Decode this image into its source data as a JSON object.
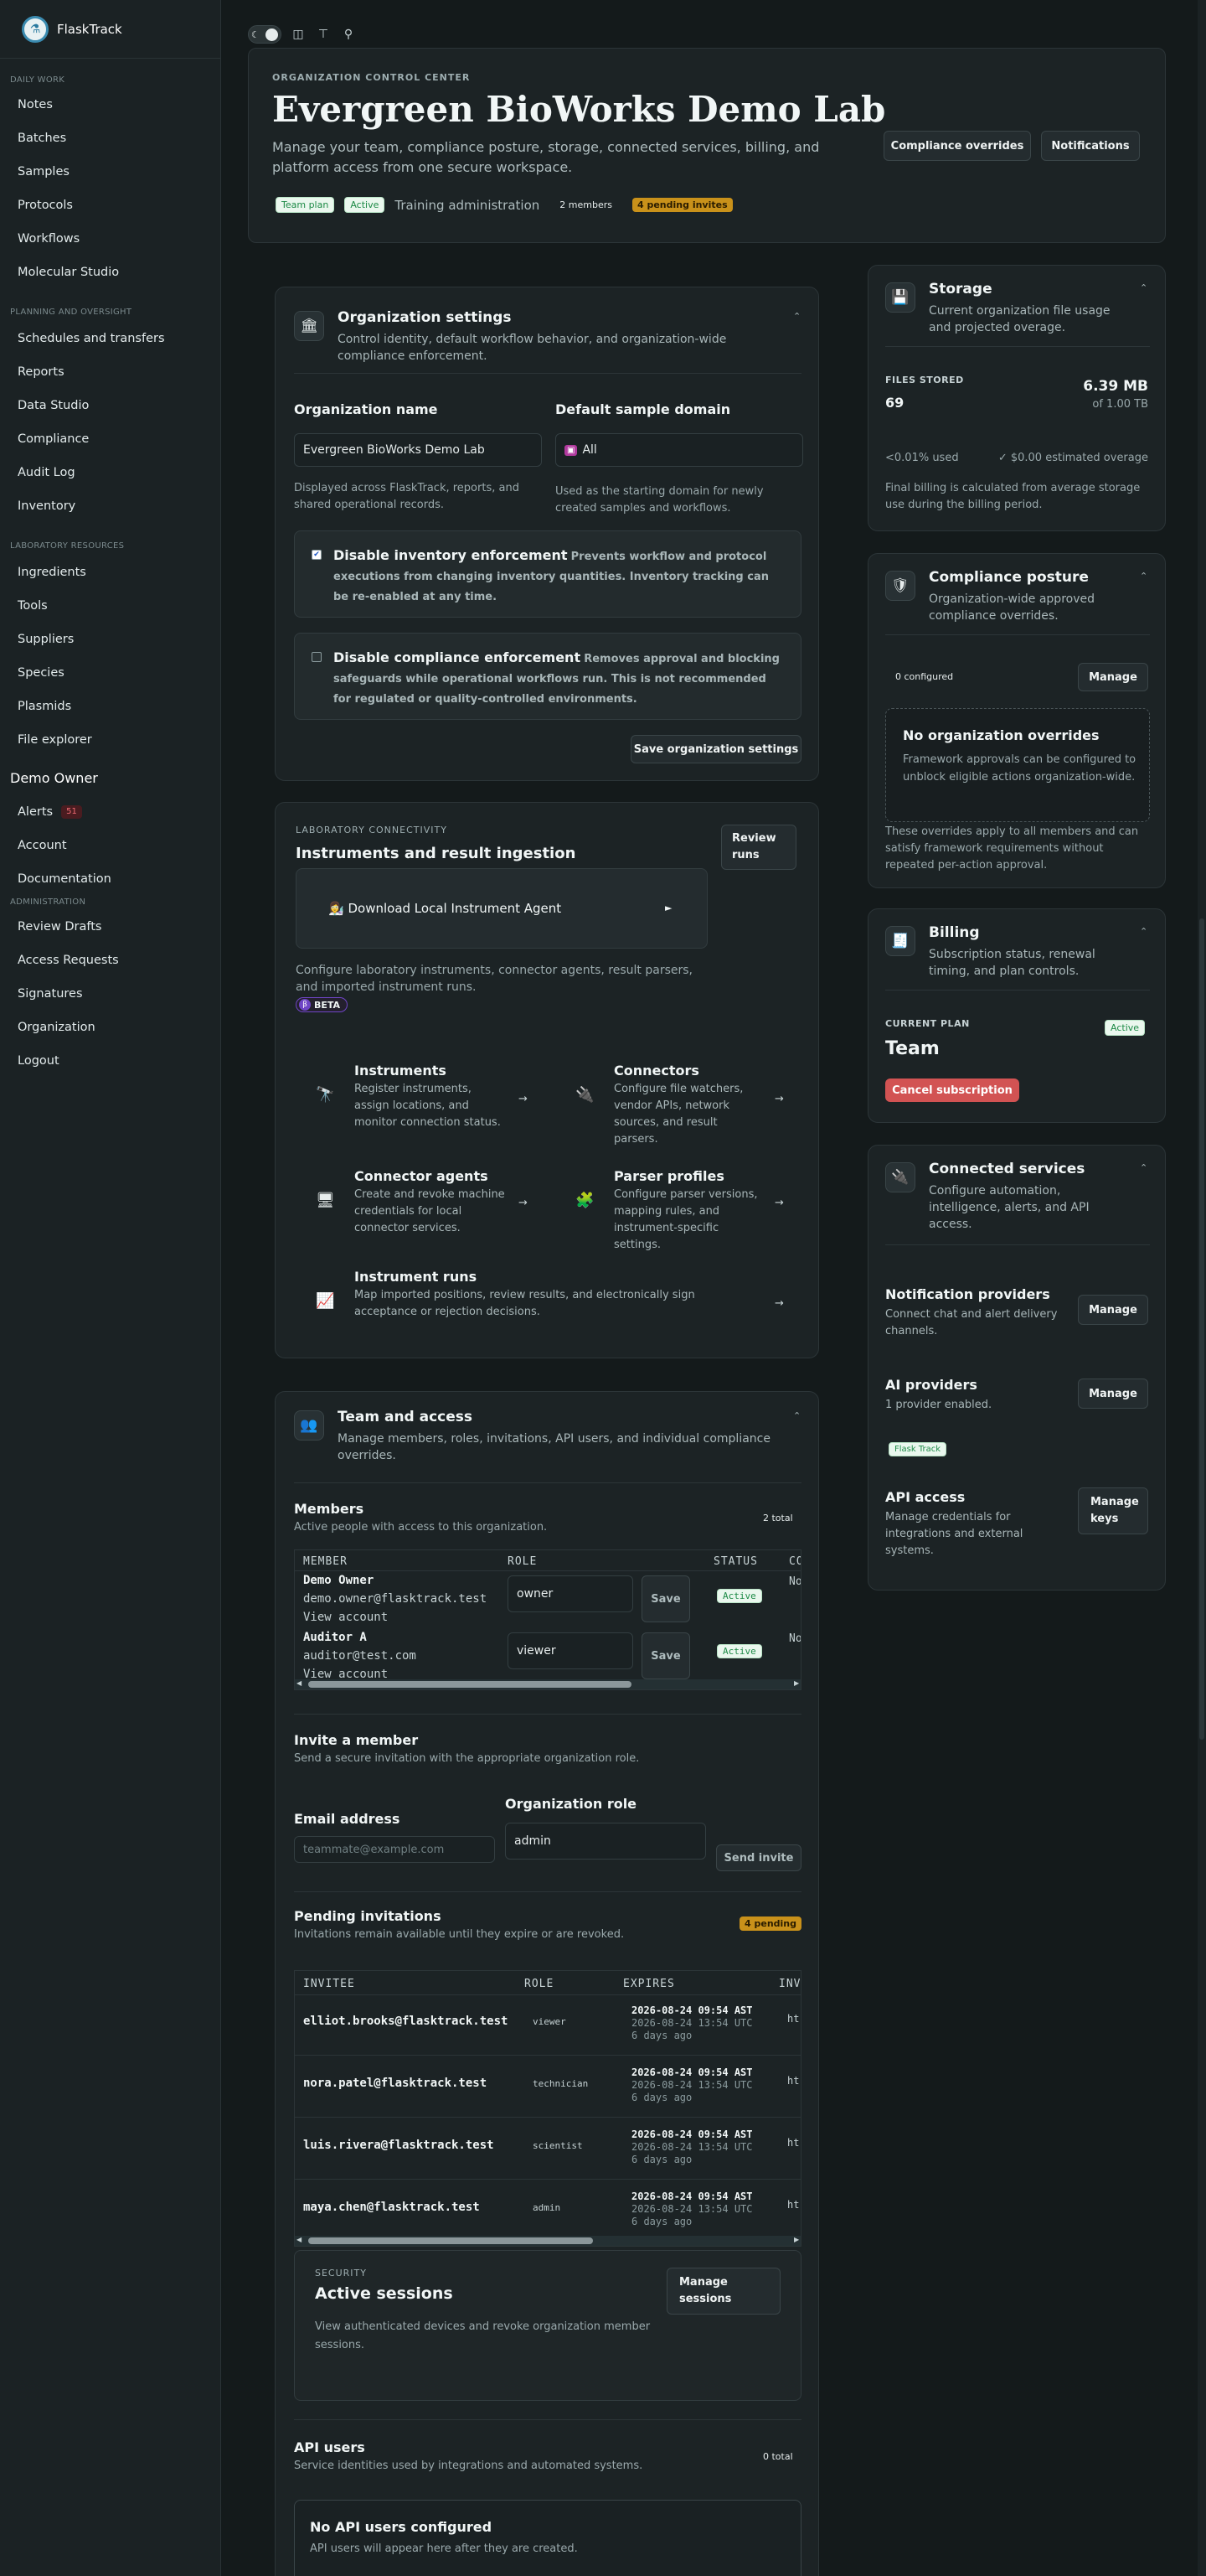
{
  "brand": {
    "name": "FlaskTrack"
  },
  "sidebar": {
    "sections": [
      {
        "title": "Daily work",
        "items": [
          "Notes",
          "Batches",
          "Samples",
          "Protocols",
          "Workflows",
          "Molecular Studio"
        ]
      },
      {
        "title": "Planning and oversight",
        "items": [
          "Schedules and transfers",
          "Reports",
          "Data Studio",
          "Compliance",
          "Audit Log",
          "Inventory"
        ]
      },
      {
        "title": "Laboratory resources",
        "items": [
          "Ingredients",
          "Tools",
          "Suppliers",
          "Species",
          "Plasmids",
          "File explorer"
        ]
      }
    ],
    "user": "Demo Owner",
    "alerts_label": "Alerts",
    "alerts_count": "51",
    "account": "Account",
    "documentation": "Documentation",
    "admin_title": "Administration",
    "admin_items": [
      "Review Drafts",
      "Access Requests",
      "Signatures",
      "Organization",
      "Logout"
    ]
  },
  "toolbar": {
    "theme_icon": "moon-icon",
    "icons": [
      "columns-icon",
      "sitemap-icon",
      "search-icon"
    ]
  },
  "header": {
    "eyebrow": "Organization control center",
    "title": "Evergreen BioWorks Demo Lab",
    "lead": "Manage your team, compliance posture, storage, connected services, billing, and platform access from one secure workspace.",
    "plan_pill": "Team plan",
    "active_pill": "Active",
    "training": "Training administration",
    "members": "2 members",
    "pending": "4 pending invites",
    "btn_overrides": "Compliance overrides",
    "btn_notifications": "Notifications"
  },
  "org_settings": {
    "title": "Organization settings",
    "desc": "Control identity, default workflow behavior, and organization-wide compliance enforcement.",
    "name_label": "Organization name",
    "name_value": "Evergreen BioWorks Demo Lab",
    "name_help": "Displayed across FlaskTrack, reports, and shared operational records.",
    "domain_label": "Default sample domain",
    "domain_value": "All",
    "domain_help": "Used as the starting domain for newly created samples and workflows.",
    "inv_title": "Disable inventory enforcement",
    "inv_desc": "Prevents workflow and protocol executions from changing inventory quantities. Inventory tracking can be re-enabled at any time.",
    "comp_title": "Disable compliance enforcement",
    "comp_desc": "Removes approval and blocking safeguards while operational workflows run. This is not recommended for regulated or quality-controlled environments.",
    "save": "Save organization settings"
  },
  "connectivity": {
    "eyebrow": "Laboratory connectivity",
    "title": "Instruments and result ingestion",
    "review_btn": "Review runs",
    "download": "Download Local Instrument Agent",
    "desc": "Configure laboratory instruments, connector agents, result parsers, and imported instrument runs.",
    "beta": "BETA",
    "tiles": [
      {
        "title": "Instruments",
        "desc": "Register instruments, assign locations, and monitor connection status.",
        "icon": "microscope-icon"
      },
      {
        "title": "Connectors",
        "desc": "Configure file watchers, vendor APIs, network sources, and result parsers.",
        "icon": "plug-icon"
      },
      {
        "title": "Connector agents",
        "desc": "Create and revoke machine credentials for local connector services.",
        "icon": "computer-icon"
      },
      {
        "title": "Parser profiles",
        "desc": "Configure parser versions, mapping rules, and instrument-specific settings.",
        "icon": "puzzle-icon"
      },
      {
        "title": "Instrument runs",
        "desc": "Map imported positions, review results, and electronically sign acceptance or rejection decisions.",
        "icon": "chart-icon"
      }
    ]
  },
  "team": {
    "title": "Team and access",
    "desc": "Manage members, roles, invitations, API users, and individual compliance overrides.",
    "members_title": "Members",
    "members_desc": "Active people with access to this organization.",
    "members_total": "2 total",
    "columns": [
      "MEMBER",
      "ROLE",
      "STATUS",
      "CO"
    ],
    "rows": [
      {
        "name": "Demo Owner",
        "email": "demo.owner@flasktrack.test",
        "view": "View account",
        "role": "owner",
        "save": "Save",
        "status": "Active",
        "extra": "No"
      },
      {
        "name": "Auditor A",
        "email": "auditor@test.com",
        "view": "View account",
        "role": "viewer",
        "save": "Save",
        "status": "Active",
        "extra": "No"
      }
    ],
    "invite_title": "Invite a member",
    "invite_desc": "Send a secure invitation with the appropriate organization role.",
    "email_label": "Email address",
    "email_placeholder": "teammate@example.com",
    "role_label": "Organization role",
    "role_value": "admin",
    "send": "Send invite",
    "pending_title": "Pending invitations",
    "pending_desc": "Invitations remain available until they expire or are revoked.",
    "pending_badge": "4 pending",
    "inv_columns": [
      "INVITEE",
      "ROLE",
      "EXPIRES",
      "INV"
    ],
    "invites": [
      {
        "email": "elliot.brooks@flasktrack.test",
        "role": "viewer",
        "ast": "2026-08-24 09:54 AST",
        "utc": "2026-08-24 13:54 UTC",
        "ago": "6 days ago",
        "link": "ht"
      },
      {
        "email": "nora.patel@flasktrack.test",
        "role": "technician",
        "ast": "2026-08-24 09:54 AST",
        "utc": "2026-08-24 13:54 UTC",
        "ago": "6 days ago",
        "link": "ht"
      },
      {
        "email": "luis.rivera@flasktrack.test",
        "role": "scientist",
        "ast": "2026-08-24 09:54 AST",
        "utc": "2026-08-24 13:54 UTC",
        "ago": "6 days ago",
        "link": "ht"
      },
      {
        "email": "maya.chen@flasktrack.test",
        "role": "admin",
        "ast": "2026-08-24 09:54 AST",
        "utc": "2026-08-24 13:54 UTC",
        "ago": "6 days ago",
        "link": "ht"
      }
    ],
    "security_eyebrow": "Security",
    "sessions_title": "Active sessions",
    "sessions_desc": "View authenticated devices and revoke organization member sessions.",
    "sessions_btn": "Manage sessions",
    "api_title": "API users",
    "api_desc": "Service identities used by integrations and automated systems.",
    "api_total": "0 total",
    "no_api_title": "No API users configured",
    "no_api_desc": "API users will appear here after they are created."
  },
  "storage": {
    "title": "Storage",
    "desc": "Current organization file usage and projected overage.",
    "files_label": "FILES STORED",
    "files_count": "69",
    "size": "6.39 MB",
    "of": "of 1.00 TB",
    "used": "<0.01% used",
    "overage": "✓ $0.00 estimated overage",
    "note": "Final billing is calculated from average storage use during the billing period."
  },
  "compliance": {
    "title": "Compliance posture",
    "desc": "Organization-wide approved compliance overrides.",
    "configured": "0 configured",
    "manage": "Manage",
    "empty_title": "No organization overrides",
    "empty_desc": "Framework approvals can be configured to unblock eligible actions organization-wide.",
    "note": "These overrides apply to all members and can satisfy framework requirements without repeated per-action approval."
  },
  "billing": {
    "title": "Billing",
    "desc": "Subscription status, renewal timing, and plan controls.",
    "plan_label": "CURRENT PLAN",
    "status": "Active",
    "plan": "Team",
    "cancel": "Cancel subscription"
  },
  "services": {
    "title": "Connected services",
    "desc": "Configure automation, intelligence, alerts, and API access.",
    "notif_title": "Notification providers",
    "notif_desc": "Connect chat and alert delivery channels.",
    "notif_btn": "Manage",
    "ai_title": "AI providers",
    "ai_desc": "1 provider enabled.",
    "ai_btn": "Manage",
    "ai_tag": "Flask Track",
    "api_title": "API access",
    "api_desc": "Manage credentials for integrations and external systems.",
    "api_btn": "Manage keys"
  },
  "colors": {
    "accent": "#c9911a",
    "danger": "#d25353",
    "success": "#1d8a46"
  }
}
